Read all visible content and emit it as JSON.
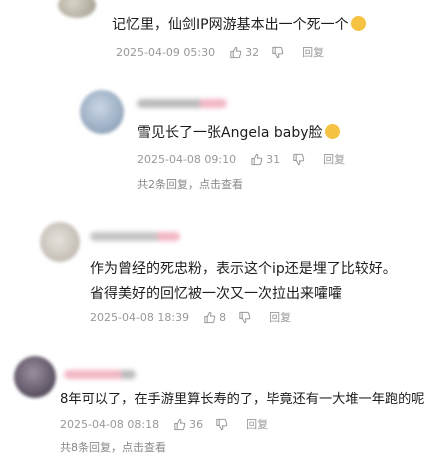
{
  "comments": [
    {
      "text": "记忆里，仙剑IP网游基本出一个死一个",
      "emoji": "crying-face",
      "date": "2025-04-09 05:30",
      "likes": "32",
      "reply_label": "回复"
    },
    {
      "text": "雪见长了一张Angela baby脸",
      "emoji": "grinning-face",
      "date": "2025-04-08 09:10",
      "likes": "31",
      "reply_label": "回复",
      "sub_replies": "共2条回复，点击查看"
    },
    {
      "text_line1": "作为曾经的死忠粉，表示这个ip还是埋了比较好。",
      "text_line2": "省得美好的回忆被一次又一次拉出来嚯嚯",
      "date": "2025-04-08 18:39",
      "likes": "8",
      "reply_label": "回复"
    },
    {
      "text": "8年可以了，在手游里算长寿的了，毕竟还有一大堆一年跑的呢",
      "date": "2025-04-08 08:18",
      "likes": "36",
      "reply_label": "回复",
      "sub_replies": "共8条回复，点击查看"
    }
  ],
  "colors": {
    "meta_gray": "#999999",
    "emoji_yellow": "#f5c242",
    "username_pink": "#f2b6c4"
  }
}
